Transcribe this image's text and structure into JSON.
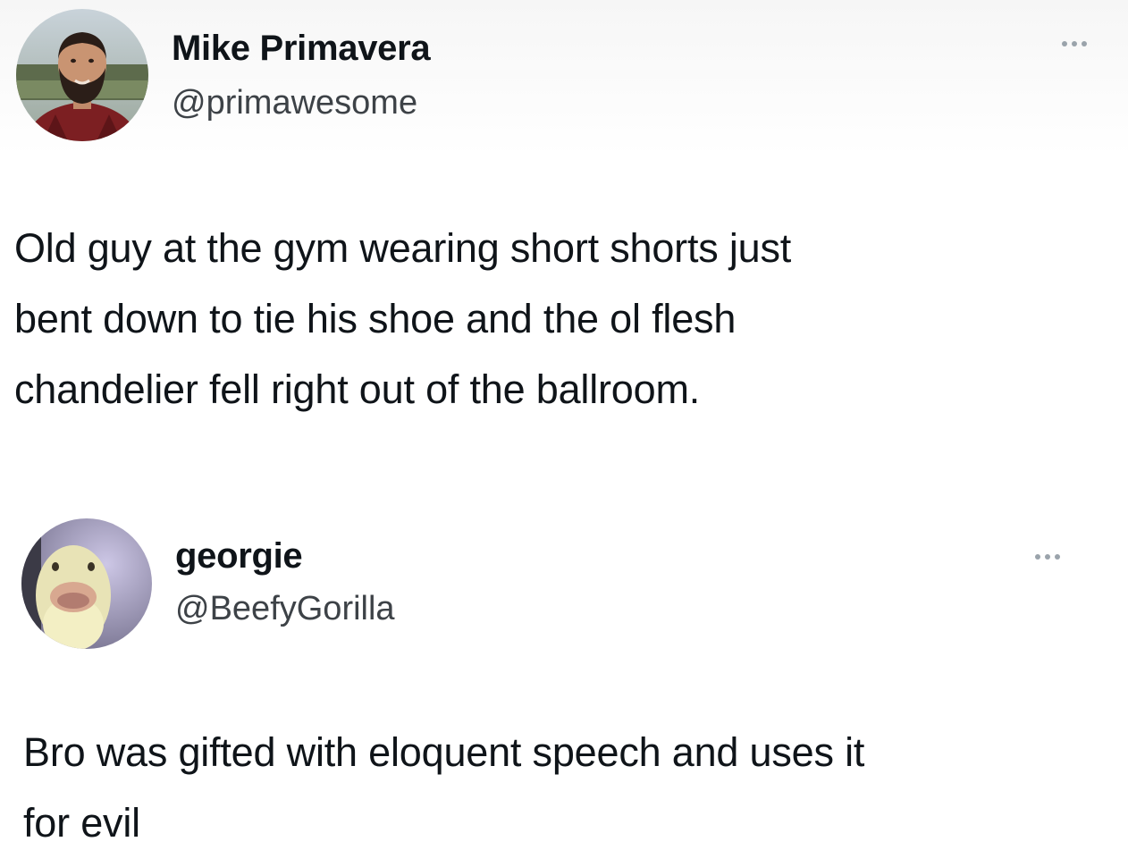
{
  "tweets": [
    {
      "author": {
        "display_name": "Mike Primavera",
        "handle": "@primawesome",
        "avatar_icon": "avatar-bearded-man"
      },
      "more_icon": "more-options-icon",
      "text_lines": [
        "Old guy at the gym wearing short shorts just",
        "bent down to tie his shoe and the ol flesh",
        "chandelier fell right out of the ballroom."
      ]
    },
    {
      "author": {
        "display_name": "georgie",
        "handle": "@BeefyGorilla",
        "avatar_icon": "avatar-duck"
      },
      "more_icon": "more-options-icon",
      "text_lines": [
        "Bro was gifted with eloquent speech and uses it",
        "for evil"
      ]
    }
  ],
  "colors": {
    "text": "#0f1419",
    "handle": "#3d4247",
    "more_dots": "#9aa3ab",
    "background": "#ffffff"
  }
}
